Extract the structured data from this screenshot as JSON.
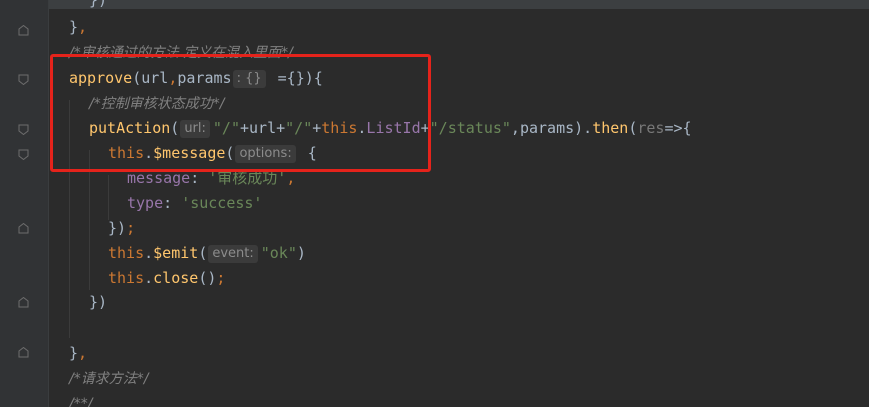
{
  "colors": {
    "background": "#2b2b2b",
    "gutter": "#313335",
    "keyword": "#cc7832",
    "function": "#ffc66d",
    "string": "#6a8759",
    "property": "#9876aa",
    "comment": "#808080",
    "highlight_border": "#e5231b"
  },
  "code": {
    "line_top_partial": "})",
    "line_close1_brace": "}",
    "line_close1_comma": ",",
    "comment_mixin": "/*审核通过的方法 定义在混入里面*/",
    "approve_name": "approve",
    "approve_paren_open": "(url",
    "approve_comma": ",",
    "approve_params": "params",
    "approve_hint": ": {}",
    "approve_rest": " ={}){",
    "comment_status": "/*控制审核状态成功*/",
    "put_action": "putAction",
    "put_paren": "(",
    "put_hint": "url:",
    "put_str1": "\"/\"",
    "put_plus_url": "+url+",
    "put_str2": "\"/\"",
    "put_plus1": "+",
    "put_this": "this",
    "put_dot": ".",
    "put_listid": "ListId",
    "put_plus2": "+",
    "put_str3": "\"/status\"",
    "put_params": ",params).",
    "put_then": "then",
    "put_res_open": "(",
    "put_res": "res",
    "put_arrow": "=>{",
    "this_message_this": "this",
    "this_message_dot": ".",
    "this_message_name": "$message",
    "this_message_paren": "(",
    "message_hint": "options:",
    "message_brace": " {",
    "message_key": "message",
    "message_colon": ": ",
    "message_val": "'审核成功'",
    "message_comma": ",",
    "type_key": "type",
    "type_colon": ": ",
    "type_val": "'success'",
    "close_obj": "})",
    "close_obj_semi": ";",
    "emit_this": "this",
    "emit_dot": ".",
    "emit_name": "$emit",
    "emit_paren": "(",
    "emit_hint": "event:",
    "emit_val": "\"ok\"",
    "emit_close": ")",
    "close_this": "this",
    "close_dot": ".",
    "close_name": "close",
    "close_parens": "()",
    "close_semi": ";",
    "then_close": "})",
    "method_close_brace": "}",
    "method_close_comma": ",",
    "comment_request": "/*请求方法*/",
    "comment_doc": "/**/"
  }
}
